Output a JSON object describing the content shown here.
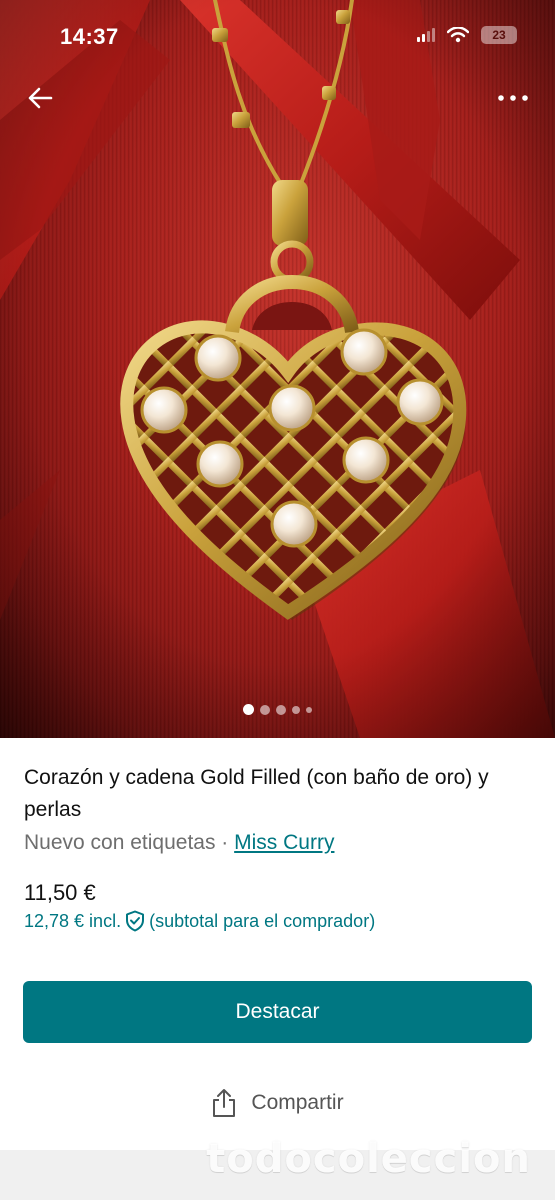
{
  "status_bar": {
    "time": "14:37",
    "battery": "23"
  },
  "gallery": {
    "image_count": 5,
    "active_index": 0
  },
  "item": {
    "title": "Corazón y cadena Gold Filled (con baño de oro) y perlas",
    "condition": "Nuevo con etiquetas",
    "separator": " · ",
    "brand": "Miss Curry",
    "price": "11,50 €",
    "price_incl": "12,78 € incl.",
    "price_incl_note": "(subtotal para el comprador)"
  },
  "actions": {
    "promote_label": "Destacar",
    "share_label": "Compartir"
  },
  "watermark": "todocoleccion",
  "colors": {
    "accent": "#007782",
    "ribbon": "#b5201c",
    "gold": "#c9a53a"
  },
  "icons": {
    "back": "arrow-left-icon",
    "more": "more-horizontal-icon",
    "shield": "shield-check-icon",
    "share": "share-icon"
  }
}
